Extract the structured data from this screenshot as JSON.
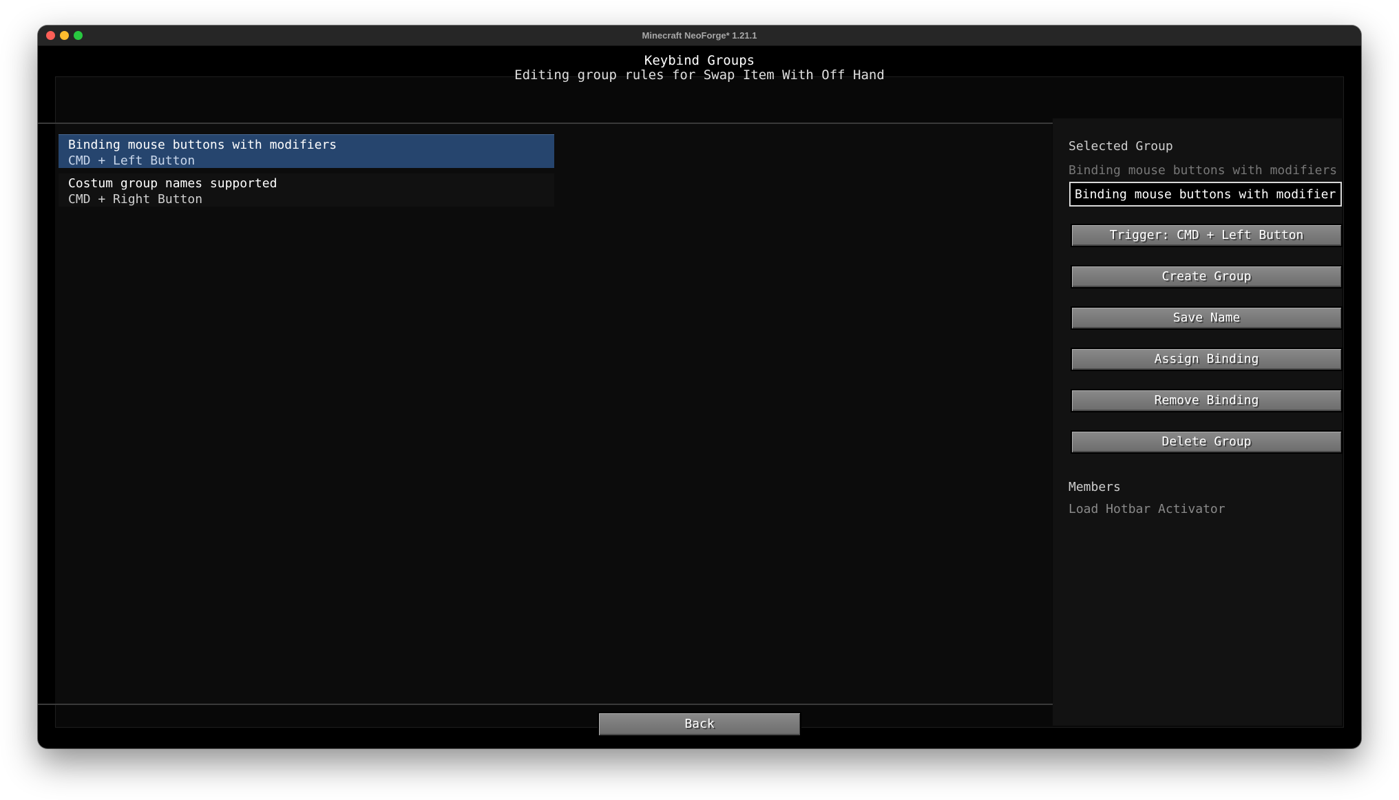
{
  "window": {
    "title": "Minecraft NeoForge* 1.21.1"
  },
  "header": {
    "title": "Keybind Groups",
    "subtitle": "Editing group rules for Swap Item With Off Hand"
  },
  "groups": [
    {
      "name": "Binding mouse buttons with modifiers",
      "binding": "CMD + Left Button",
      "selected": true
    },
    {
      "name": "Costum group names supported",
      "binding": "CMD + Right Button",
      "selected": false
    }
  ],
  "selected_group": {
    "heading": "Selected Group",
    "current_name": "Binding mouse buttons with modifiers",
    "name_input_value": "Binding mouse buttons with modifiers",
    "buttons": {
      "trigger": "Trigger: CMD + Left Button",
      "create": "Create Group",
      "save": "Save Name",
      "assign": "Assign Binding",
      "remove": "Remove Binding",
      "delete": "Delete Group"
    },
    "members_heading": "Members",
    "members": [
      "Load Hotbar Activator"
    ]
  },
  "footer": {
    "back_label": "Back"
  },
  "colors": {
    "selected_row": "#26456e",
    "button_face": "#7a7a7a",
    "background": "#000000"
  }
}
